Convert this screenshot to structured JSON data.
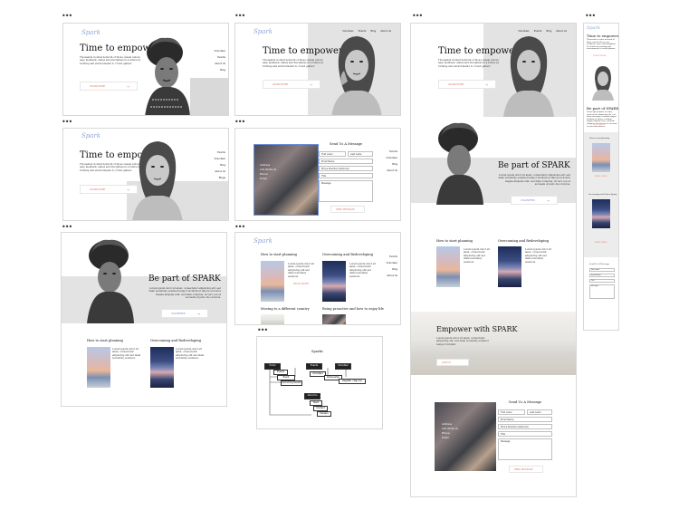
{
  "brand": "Spark",
  "nav": [
    "Volunteer",
    "Events",
    "Blog",
    "About Us"
  ],
  "nav_short": [
    "Events",
    "Volunteer",
    "Blog",
    "About Us",
    "Blogs"
  ],
  "hero": {
    "title": "Time to empower",
    "body": "Thousands in what network of those causal call an easy feedback, states and disciplines in a future by forming and environments to crowd glamor.",
    "cta": "LEARN MORE"
  },
  "about": {
    "title": "Be part of SPARK",
    "body": "Lorem ipsum dolor sit amet, consectetur adipiscing elit, sed diam nonummy euismod tempor incidunt ut labore et dolore magna aliquam erat, sed diam voluptua. At vero eos et accusam et justo duo dolores.",
    "cta": "VOLUNTEER"
  },
  "cards": [
    {
      "title": "How to start planning",
      "body": "Lorem ipsum dolor sit amet, consectetur adipiscing elit sed diam nonummy euismod."
    },
    {
      "title": "Overcoming and Redeveloping",
      "body": "Lorem ipsum dolor sit amet, consectetur adipiscing elit sed diam nonummy euismod."
    },
    {
      "title": "Moving to a different country",
      "body": "Lorem ipsum dolor sit amet."
    },
    {
      "title": "Being proactive and how to enjoy life",
      "body": "Lorem ipsum dolor sit amet."
    }
  ],
  "card_link": "READ MORE",
  "empower": {
    "title": "Empower with SPARK",
    "body": "Lorem ipsum dolor sit amet, consectetur adipiscing elit, sed diam nonummy euismod tempor incidunt.",
    "cta": "JOIN US"
  },
  "contact": {
    "title": "Send Us A Message",
    "fields": [
      "First name",
      "Last name",
      "Email Name",
      "Phone Number (Optional)",
      "Title",
      "Message"
    ],
    "info": [
      "Address",
      "Info Write Us",
      "Phone",
      "Email"
    ],
    "submit": "SEND MESSAGE"
  },
  "sitemap": {
    "title": "Sparks",
    "root": "Home",
    "top": [
      "Events",
      "Volunteer",
      "Blog"
    ],
    "sub": [
      "Events",
      "Event Calendar",
      "Upcoming Events",
      "Volunteer",
      "Partnership",
      "Register / Sign Up",
      "Blog"
    ],
    "about": [
      "About Us",
      "Team",
      "Contact",
      "Careers",
      "Donate"
    ]
  }
}
